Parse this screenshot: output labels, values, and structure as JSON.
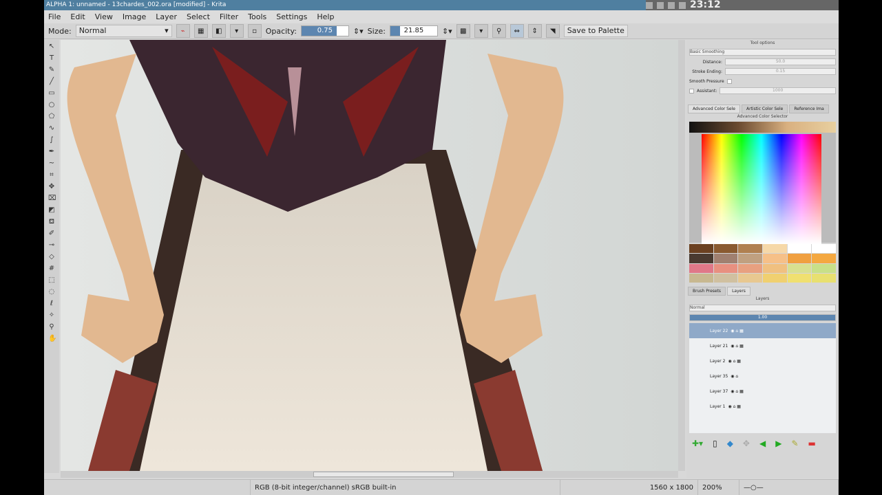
{
  "window": {
    "title": "ALPHA 1: unnamed - 13chardes_002.ora [modified] - Krita",
    "clock": "23:12"
  },
  "menu": [
    "File",
    "Edit",
    "View",
    "Image",
    "Layer",
    "Select",
    "Filter",
    "Tools",
    "Settings",
    "Help"
  ],
  "toolbar": {
    "mode_label": "Mode:",
    "mode_value": "Normal",
    "opacity_label": "Opacity:",
    "opacity_value": "0.75",
    "opacity_fraction": 0.75,
    "size_label": "Size:",
    "size_value": "21.85",
    "save_palette": "Save to Palette"
  },
  "tool_options": {
    "title": "Tool options",
    "smoothing": "Basic Smoothing",
    "distance_label": "Distance:",
    "distance_value": "50.0",
    "stroke_ending_label": "Stroke Ending:",
    "stroke_ending_value": "0.15",
    "smooth_pressure_label": "Smooth Pressure",
    "assistant_label": "Assistant:",
    "assistant_value": "1000"
  },
  "color_tabs": [
    "Advanced Color Sele",
    "Artistic Color Sele",
    "Reference Ima"
  ],
  "color_selector_title": "Advanced Color Selector",
  "swatch_colors": [
    "#6b4020",
    "#8a5a30",
    "#b08050",
    "#f6d8a8",
    "#ffffff",
    "#ffffff",
    "#4a3a30",
    "#a08070",
    "#c0a080",
    "#f6c088",
    "#f0a040",
    "#f4a840",
    "#e07888",
    "#e89080",
    "#e8a080",
    "#f0c080",
    "#d8e090",
    "#c8e088",
    "#c8b890",
    "#d0c0a0",
    "#e8c890",
    "#f0d070",
    "#f0e070",
    "#e8e070"
  ],
  "layer_tabs": [
    "Brush Presets",
    "Layers"
  ],
  "layers_panel": {
    "title": "Layers",
    "blend": "Normal",
    "opacity": "1.00"
  },
  "layers": [
    {
      "name": "Layer 22",
      "selected": true
    },
    {
      "name": "Layer 21"
    },
    {
      "name": "Layer 2"
    },
    {
      "name": "Layer 35"
    },
    {
      "name": "Layer 37"
    },
    {
      "name": "Layer 1"
    }
  ],
  "status": {
    "colorspace": "RGB (8-bit integer/channel)  sRGB built-in",
    "dimensions": "1560 x 1800",
    "zoom": "200%"
  }
}
